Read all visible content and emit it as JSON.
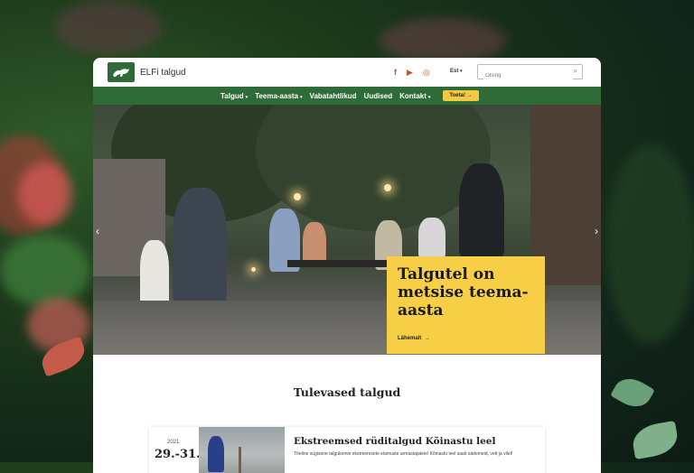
{
  "header": {
    "brand": "ELFi talgud",
    "social": [
      {
        "icon": "facebook-icon",
        "glyph": "f"
      },
      {
        "icon": "youtube-icon",
        "glyph": "▶"
      },
      {
        "icon": "instagram-icon",
        "glyph": "◎"
      }
    ],
    "language": "Est",
    "search_placeholder": "Otsing"
  },
  "nav": {
    "items": [
      "Talgud",
      "Teema-aasta",
      "Vabatahtlikud",
      "Uudised",
      "Kontakt"
    ],
    "cta_label": "Toeta!"
  },
  "hero": {
    "headline": "Talgutel on metsise teema-aasta",
    "more_label": "Lähemalt"
  },
  "upcoming": {
    "section_title": "Tulevased talgud",
    "event": {
      "year": "2021",
      "date": "29.-31.",
      "title": "Ekstreemsed rüditalgud Kõinastu leel",
      "description": "Tõeline sügisene talgukomin ekstreemsete elamuste armastajatele! Kõinastu leel saab sädemeid, vett ja vilet!"
    }
  },
  "colors": {
    "brand_green": "#2e6b38",
    "accent_yellow": "#f6cf47",
    "social_orange": "#c8532a"
  }
}
